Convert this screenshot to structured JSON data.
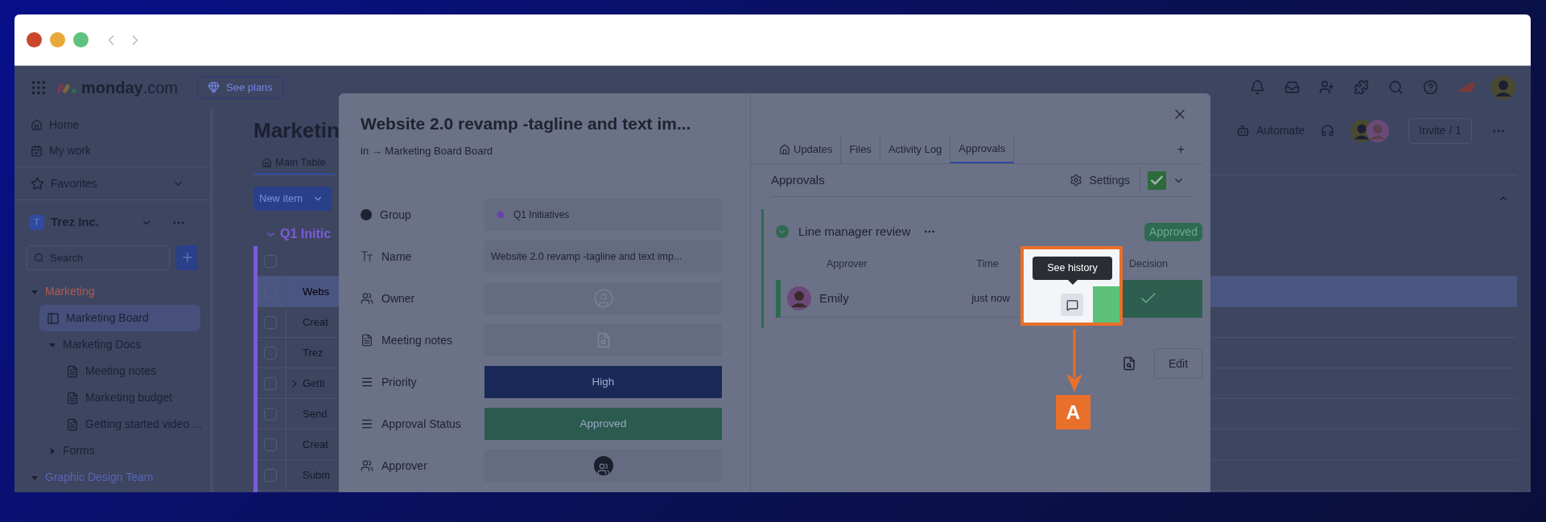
{
  "topbar": {
    "brand": "monday",
    "brand_suffix": ".com",
    "plans_button": "See plans"
  },
  "sidebar": {
    "nav": [
      {
        "label": "Home"
      },
      {
        "label": "My work"
      }
    ],
    "favorites": "Favorites",
    "workspace": {
      "initial": "T",
      "name": "Trez Inc."
    },
    "search": {
      "placeholder": "Search"
    },
    "tree": [
      {
        "label": "Marketing",
        "kind": "folder",
        "color": "#b5594f",
        "expanded": true,
        "selected": false,
        "children": [
          {
            "label": "Marketing Board",
            "kind": "board",
            "selected": true
          },
          {
            "label": "Marketing Docs",
            "kind": "folder",
            "expanded": true,
            "selected": false,
            "children": [
              {
                "label": "Meeting notes",
                "kind": "doc",
                "selected": false
              },
              {
                "label": "Marketing budget",
                "kind": "doc",
                "selected": false
              },
              {
                "label": "Getting started video ...",
                "kind": "doc",
                "selected": false
              }
            ]
          },
          {
            "label": "Forms",
            "kind": "folder",
            "expanded": false,
            "selected": false
          }
        ]
      },
      {
        "label": "Graphic Design Team",
        "kind": "folder",
        "color": "#5565b8",
        "expanded": true,
        "selected": false
      }
    ]
  },
  "board": {
    "title": "Marketin",
    "automate": "Automate",
    "all_checked": false,
    "invite_button": "Invite / 1",
    "tab": "Main Table",
    "new_item_button": "New item",
    "group": {
      "name": "Q1 Initic",
      "color": "#7a5cd8",
      "expanded": true
    },
    "rows": [
      {
        "name": "Webs",
        "selected": true,
        "checked": false,
        "has_subitems": false
      },
      {
        "name": "Creat",
        "selected": false,
        "checked": false,
        "has_subitems": false
      },
      {
        "name": "Trez",
        "selected": false,
        "checked": false,
        "has_subitems": false
      },
      {
        "name": "Getti",
        "selected": false,
        "checked": false,
        "has_subitems": true
      },
      {
        "name": "Send",
        "selected": false,
        "checked": false,
        "has_subitems": false
      },
      {
        "name": "Creat",
        "selected": false,
        "checked": false,
        "has_subitems": false
      },
      {
        "name": "Subm",
        "selected": false,
        "checked": false,
        "has_subitems": false
      }
    ]
  },
  "item_modal": {
    "title": "Website 2.0 revamp -tagline and text im...",
    "breadcrumb": "in → Marketing Board Board",
    "fields": [
      {
        "label": "Group",
        "kind": "group",
        "value": "Q1 Initiatives",
        "color": "#6b3fb0"
      },
      {
        "label": "Name",
        "kind": "text",
        "value": "Website 2.0 revamp -tagline and text imp..."
      },
      {
        "label": "Owner",
        "kind": "person",
        "assigned": false
      },
      {
        "label": "Meeting notes",
        "kind": "doc"
      },
      {
        "label": "Priority",
        "kind": "status",
        "value": "High",
        "color": "#1a2a58"
      },
      {
        "label": "Approval Status",
        "kind": "status",
        "value": "Approved",
        "color": "#2a5b4e"
      },
      {
        "label": "Approver",
        "kind": "person",
        "assigned": true
      }
    ],
    "tabs": [
      {
        "label": "Updates",
        "selected": false
      },
      {
        "label": "Files",
        "selected": false
      },
      {
        "label": "Activity Log",
        "selected": false
      },
      {
        "label": "Approvals",
        "selected": true
      }
    ],
    "add_tab": "+",
    "approvals": {
      "title": "Approvals",
      "settings": "Settings",
      "approved": true,
      "stage": {
        "name": "Line manager review",
        "expanded": true,
        "status": "Approved",
        "columns": [
          "Approver",
          "Time",
          "Decision"
        ],
        "rows": [
          {
            "approver": "Emily",
            "time": "just now",
            "approved": true
          }
        ]
      },
      "edit_button": "Edit"
    },
    "tooltip": "See history"
  },
  "annotation": {
    "label": "A"
  }
}
